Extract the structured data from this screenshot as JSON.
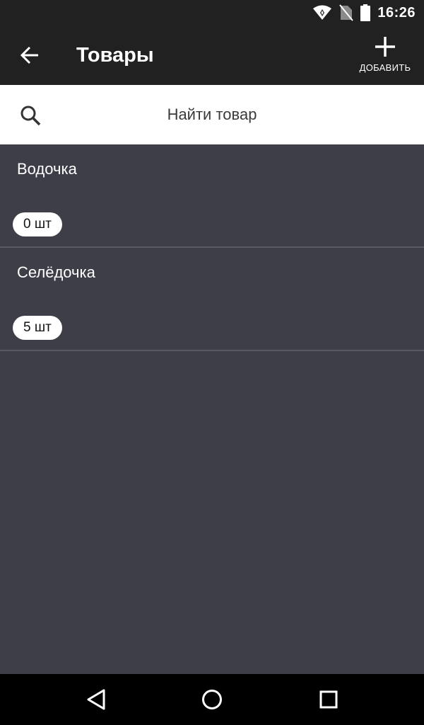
{
  "status_bar": {
    "time": "16:26",
    "icons": [
      "wifi-icon",
      "no-sim-icon",
      "battery-icon"
    ]
  },
  "toolbar": {
    "title": "Товары",
    "back_icon": "arrow-left-icon",
    "add_icon": "plus-icon",
    "add_label": "ДОБАВИТЬ"
  },
  "search": {
    "icon": "search-icon",
    "placeholder": "Найти товар",
    "value": ""
  },
  "products": [
    {
      "name": "Водочка",
      "quantity": "0 шт"
    },
    {
      "name": "Селёдочка",
      "quantity": "5 шт"
    }
  ],
  "nav_bar": {
    "icons": [
      "nav-back-icon",
      "nav-home-icon",
      "nav-recent-icon"
    ]
  },
  "colors": {
    "toolbar_bg": "#212121",
    "list_bg": "#3e3e48",
    "divider": "#5a5a64",
    "search_bg": "#ffffff",
    "nav_bg": "#000000"
  }
}
